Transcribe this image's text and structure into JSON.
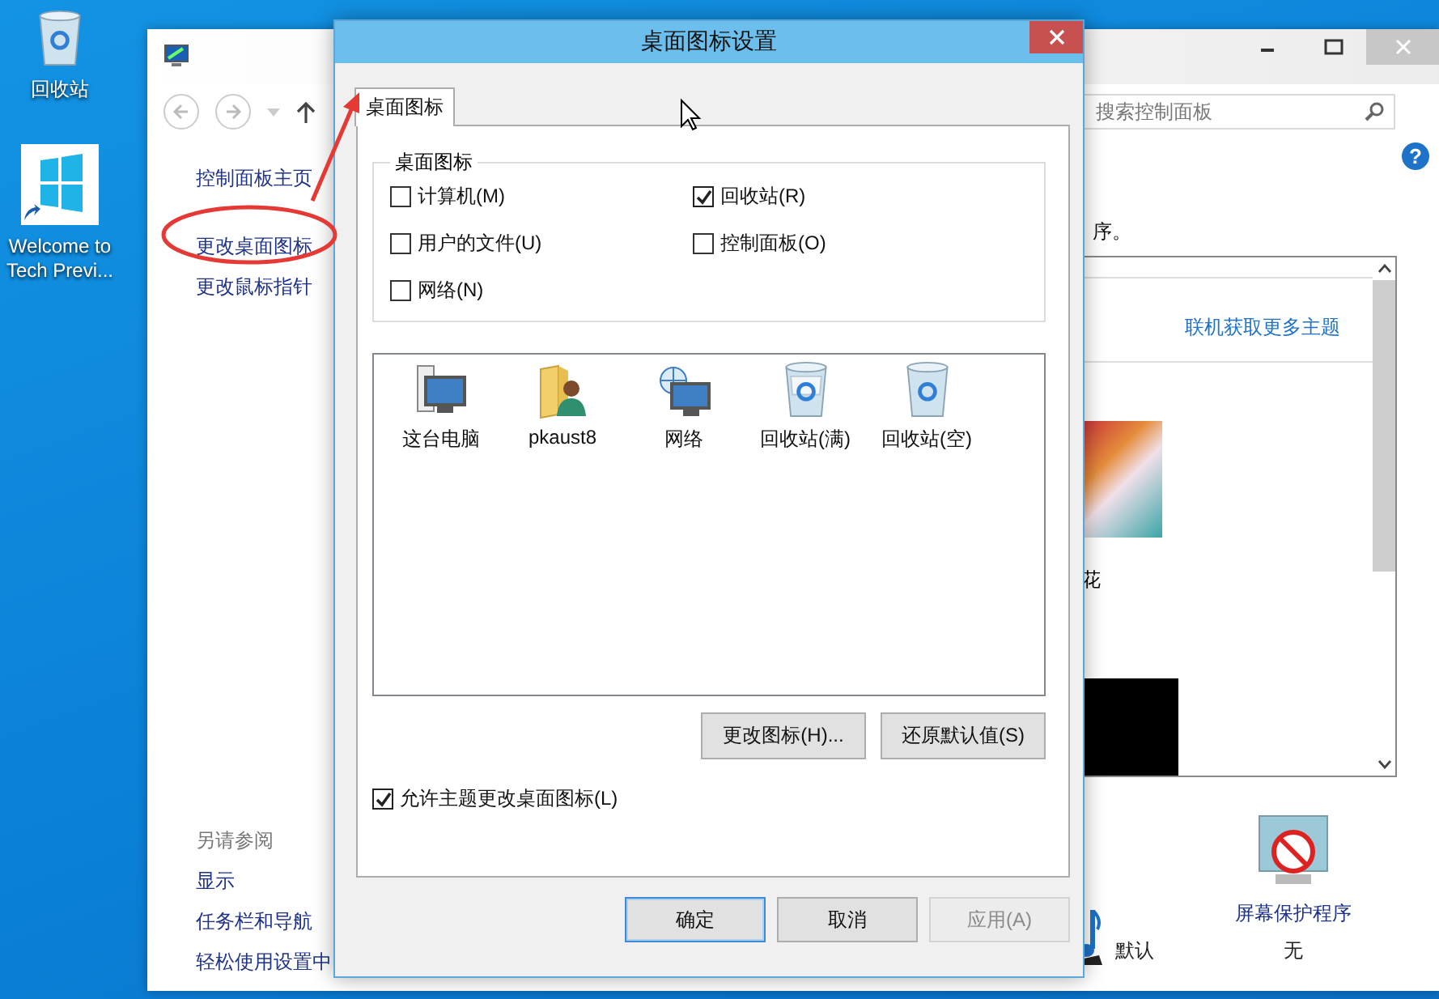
{
  "desktop": {
    "icons": [
      {
        "kind": "recycle-bin",
        "label": "回收站"
      },
      {
        "kind": "shortcut",
        "label": "Welcome to Tech Previ..."
      }
    ]
  },
  "control_panel": {
    "search": {
      "placeholder": "搜索控制面板"
    },
    "nav_links": [
      "控制面板主页",
      "更改桌面图标",
      "更改鼠标指针"
    ],
    "help_label": "?",
    "description": "序。",
    "online_link": "联机获取更多主题",
    "theme_label": "花",
    "see_also": {
      "heading": "另请参阅",
      "links": [
        "显示",
        "任务栏和导航",
        "轻松使用设置中"
      ]
    },
    "bottom_items": [
      {
        "kind": "sound",
        "label": "默认"
      },
      {
        "kind": "screensaver",
        "title": "屏幕保护程序",
        "label": "无"
      }
    ]
  },
  "dialog": {
    "title": "桌面图标设置",
    "tabs": [
      {
        "label": "桌面图标",
        "selected": true
      }
    ],
    "group": {
      "legend": "桌面图标",
      "checkboxes": [
        {
          "label": "计算机(M)",
          "checked": false
        },
        {
          "label": "回收站(R)",
          "checked": true
        },
        {
          "label": "用户的文件(U)",
          "checked": false
        },
        {
          "label": "控制面板(O)",
          "checked": false
        },
        {
          "label": "网络(N)",
          "checked": false
        }
      ]
    },
    "icons": [
      {
        "kind": "computer",
        "label": "这台电脑"
      },
      {
        "kind": "user-folder",
        "label": "pkaust8"
      },
      {
        "kind": "network",
        "label": "网络"
      },
      {
        "kind": "recycle-full",
        "label": "回收站(满)"
      },
      {
        "kind": "recycle-empty",
        "label": "回收站(空)"
      }
    ],
    "icon_buttons": [
      "更改图标(H)...",
      "还原默认值(S)"
    ],
    "allow_theme": {
      "label": "允许主题更改桌面图标(L)",
      "checked": true
    },
    "footer_buttons": [
      {
        "label": "确定",
        "focused": true,
        "disabled": false
      },
      {
        "label": "取消",
        "focused": false,
        "disabled": false
      },
      {
        "label": "应用(A)",
        "focused": false,
        "disabled": true
      }
    ]
  }
}
